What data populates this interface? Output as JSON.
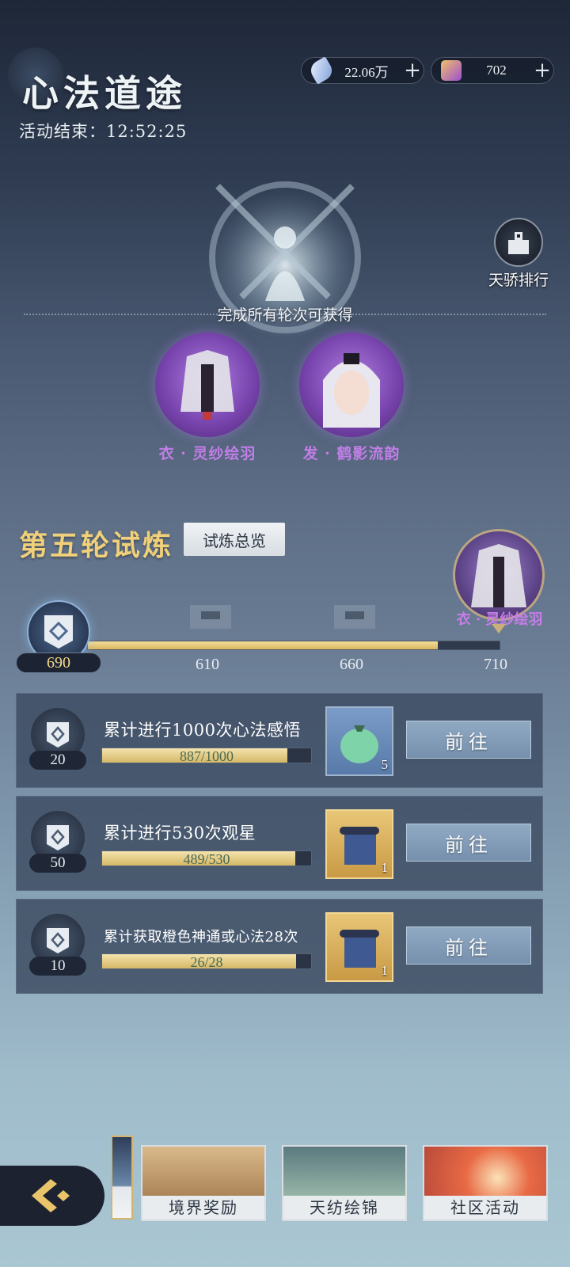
{
  "header": {
    "title": "心法道途",
    "countdown": "活动结束：12:52:25"
  },
  "currencies": [
    {
      "icon": "feather-icon",
      "value": "22.06万"
    },
    {
      "icon": "purple-token-icon",
      "value": "702"
    }
  ],
  "ranking": {
    "label": "天骄排行"
  },
  "rewards_section": {
    "caption": "完成所有轮次可获得",
    "items": [
      {
        "name": "衣 · 灵纱绘羽"
      },
      {
        "name": "发 · 鹤影流韵"
      }
    ]
  },
  "round": {
    "title": "第五轮试炼",
    "overview_label": "试炼总览",
    "current_score": "690",
    "progress_fraction": 0.85,
    "milestones": [
      "610",
      "660",
      "710"
    ],
    "final_reward_name": "衣 · 灵纱绘羽"
  },
  "tasks": [
    {
      "points": "20",
      "title": "累计进行1000次心法感悟",
      "progress_text": "887/1000",
      "progress": 0.887,
      "item_count": "5",
      "go_label": "前往"
    },
    {
      "points": "50",
      "title": "累计进行530次观星",
      "progress_text": "489/530",
      "progress": 0.923,
      "item_count": "1",
      "go_label": "前往"
    },
    {
      "points": "10",
      "title": "累计获取橙色神通或心法28次",
      "progress_text": "26/28",
      "progress": 0.929,
      "item_count": "1",
      "go_label": "前往"
    }
  ],
  "nav": [
    {
      "label": "境界奖励"
    },
    {
      "label": "天纺绘锦"
    },
    {
      "label": "社区活动"
    }
  ],
  "colors": {
    "accent_gold": "#f1d07a",
    "reward_purple": "#c27ee8"
  }
}
